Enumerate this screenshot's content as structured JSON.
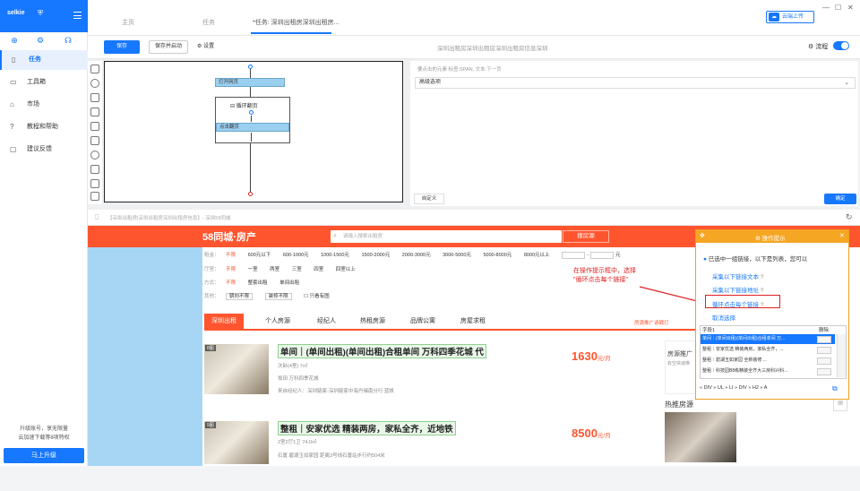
{
  "sidebar": {
    "brand": "selkie",
    "items": [
      {
        "label": "任务",
        "active": true
      },
      {
        "label": "工具箱",
        "active": false
      },
      {
        "label": "市场",
        "active": false
      },
      {
        "label": "教程和帮助",
        "active": false
      },
      {
        "label": "建议反馈",
        "active": false
      }
    ],
    "upgrade_text_1": "升级账号，享无限量",
    "upgrade_text_2": "云加速下载等8项特权",
    "upgrade_button": "马上升级"
  },
  "tabs": [
    {
      "label": "主页",
      "active": false
    },
    {
      "label": "任务",
      "active": false
    },
    {
      "label": "*任务: 深圳出租房深圳出租房...",
      "active": true
    }
  ],
  "header": {
    "cloud_button": "云端上传"
  },
  "toolbar": {
    "save": "保存",
    "save_run": "保存并启动",
    "settings": "设置",
    "task_title": "深圳出租房深圳出租房深圳出租房信息深圳",
    "flow_label": "流程"
  },
  "flow": {
    "open_page": "打开网页",
    "loop": "循环翻页",
    "click_page": "点击翻页"
  },
  "panel": {
    "hint": "要点击的元素  标签:SPAN, 文本:下一页",
    "advanced": "高级选项",
    "custom_button": "自定义",
    "confirm_button": "确定"
  },
  "browser": {
    "url": "【深圳出租房|深圳出租房深圳出租房信息】- 深圳58同城"
  },
  "site": {
    "logo": "58同城·房产",
    "search_placeholder": "请输入搜索出租房",
    "search_button": "搜房源",
    "filters": {
      "rent_label": "租金：",
      "rent_options": [
        "不限",
        "600元以下",
        "600-1000元",
        "1000-1500元",
        "1500-2000元",
        "2000-3000元",
        "3000-5000元",
        "5000-8000元",
        "8000元以上"
      ],
      "rent_unit": "元",
      "type_label": "厅室：",
      "type_options": [
        "不限",
        "一室",
        "两室",
        "三室",
        "四室",
        "四室以上"
      ],
      "mode_label": "方式：",
      "mode_options": [
        "不限",
        "整套出租",
        "单间出租"
      ],
      "other_label": "其他：",
      "other_options": [
        "朝向不限",
        "装修不限",
        "只看有图"
      ]
    },
    "tabs": [
      "深圳出租",
      "个人房源",
      "经纪人",
      "热租房源",
      "品牌公寓",
      "房屋求租"
    ],
    "promo_link": "房源推广请戳打",
    "listings": [
      {
        "tag": "8图",
        "title": "单间｜(单间出租)(单间出租)合租单间 万科四季花城 代",
        "size": "次卧(4室)   7㎡",
        "location": "坂田   万科四季花城",
        "agent": "来自经纪人：深圳链家-深圳链家中海丹储南分行   蓝帆",
        "price": "1630",
        "unit": "元/月"
      },
      {
        "tag": "9图",
        "title": "整租｜安家优选 精装两房，家私全齐，近地铁",
        "size": "2室2厅1卫   74.0㎡",
        "location": "石厦   碧湖玉如家园   距离3号线石厦站步行约504米",
        "agent": "",
        "price": "8500",
        "unit": "元/月"
      }
    ],
    "side_promo_title": "房源推广",
    "side_promo_sub": "有空快速推",
    "hot_title": "热推房源"
  },
  "annotation": {
    "line1": "在操作提示框中，选择",
    "line2": "\"循环点击每个链接\""
  },
  "popup": {
    "title": "操作提示",
    "status": "已选中一组链接，以下是列表，您可以",
    "links": [
      "采集以下链接文本",
      "采集以下链接地址",
      "循环点击每个链接",
      "取消选择"
    ],
    "col_field": "字段1",
    "col_delete": "删除",
    "rows": [
      "单间｜(单间出租)(单间出租)合租单间 万...",
      "整租｜安家优选 精装两房，家私全齐，...",
      "整租｜碧湖玉如家园 全新装修 ...",
      "整租｜科技园B8栋精装全齐大三房科兴科..."
    ],
    "breadcrumb": [
      "DIV",
      "UL",
      "LI",
      "DIV",
      "H2",
      "A"
    ]
  },
  "colors": {
    "accent": "#1677ff",
    "site_brand": "#ff552e",
    "popup_header": "#f5a623",
    "annotation": "#e02020"
  }
}
